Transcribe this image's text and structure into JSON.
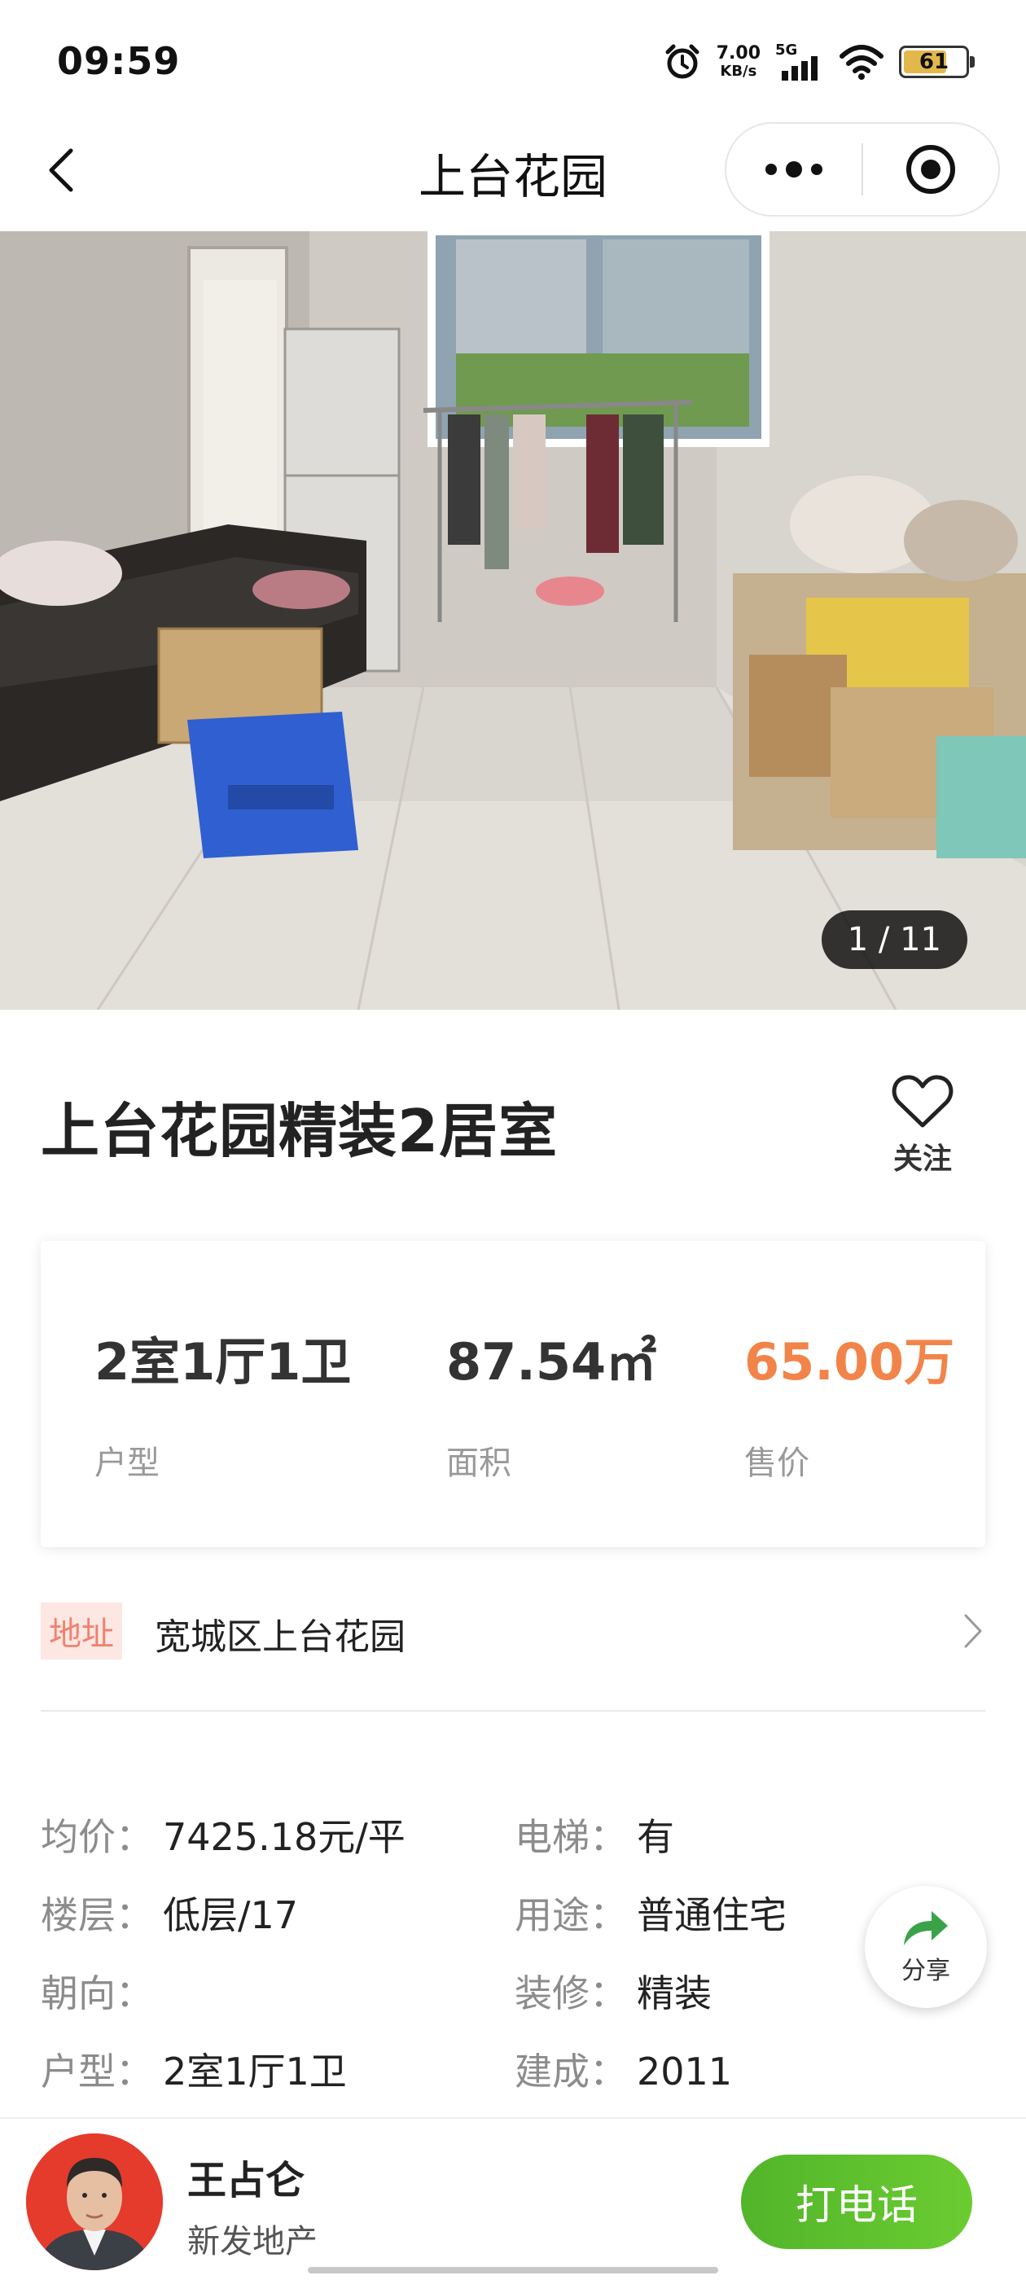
{
  "status_bar": {
    "time": "09:59",
    "speed_value": "7.00",
    "speed_unit": "KB/s",
    "network": "5G",
    "battery": "61"
  },
  "nav": {
    "title": "上台花园"
  },
  "photo": {
    "counter": "1 / 11"
  },
  "listing": {
    "title": "上台花园精装2居室",
    "follow_label": "关注"
  },
  "summary": {
    "layout_value": "2室1厅1卫",
    "layout_label": "户型",
    "area_value": "87.54㎡",
    "area_label": "面积",
    "price_value": "65.00万",
    "price_label": "售价",
    "price_color": "#f2844a"
  },
  "address": {
    "tag": "地址",
    "text": "宽城区上台花园"
  },
  "details": {
    "avg_price_label": "均价：",
    "avg_price_value": "7425.18元/平",
    "elevator_label": "电梯：",
    "elevator_value": "有",
    "floor_label": "楼层：",
    "floor_value": "低层/17",
    "usage_label": "用途：",
    "usage_value": "普通住宅",
    "orientation_label": "朝向：",
    "orientation_value": "",
    "decoration_label": "装修：",
    "decoration_value": "精装",
    "type_label": "户型：",
    "type_value": "2室1厅1卫",
    "built_label": "建成：",
    "built_value": "2011"
  },
  "share": {
    "label": "分享"
  },
  "agent": {
    "name": "王占仑",
    "company": "新发地产",
    "call_label": "打电话",
    "call_color": "#5cbf2c"
  }
}
